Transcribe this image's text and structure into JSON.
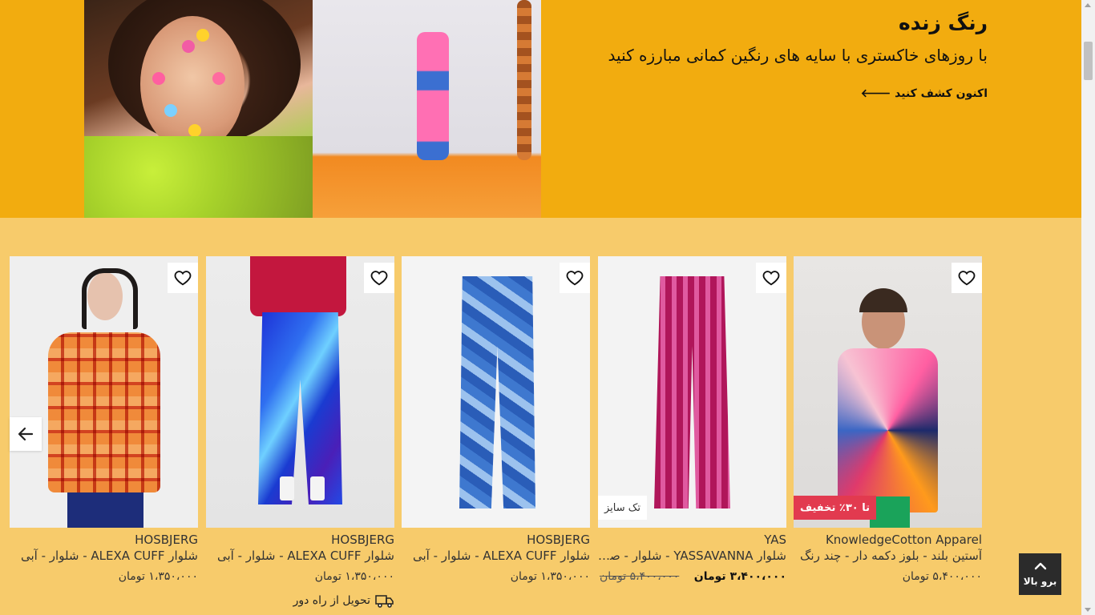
{
  "hero": {
    "title": "رنگ زنده",
    "subtitle": "با روزهای خاکستری با سایه های رنگین کمانی مبارزه کنید",
    "cta": "اکنون کشف کنید",
    "cta_icon": "arrow-left-icon",
    "background": "#f2ac0f"
  },
  "section_background": "#f7cb6b",
  "products": [
    {
      "brand": "KnowledgeCotton Apparel",
      "name": "آستین بلند - بلوز دکمه دار - چند رنگ",
      "price": "۵،۴۰۰،۰۰۰ تومان",
      "badge": "تا ۳۰٪ تخفیف",
      "image": "colorful-shirt-model"
    },
    {
      "brand": "YAS",
      "name": "شلوار YASSAVANNA - شلوار - صو...",
      "price_new": "۳،۴۰۰،۰۰۰ تومان",
      "price_old": "۵،۴۰۰،۰۰۰ تومان",
      "badge": "تک سایز",
      "image": "striped-magenta-trousers"
    },
    {
      "brand": "HOSBJERG",
      "name": "شلوار ALEXA CUFF - شلوار - آبی",
      "price": "۱،۳۵۰،۰۰۰ تومان",
      "image": "blue-patterned-jeans"
    },
    {
      "brand": "HOSBJERG",
      "name": "شلوار ALEXA CUFF - شلوار - آبی",
      "price": "۱،۳۵۰،۰۰۰ تومان",
      "delivery": "تحویل از راه دور",
      "delivery_icon": "truck-icon",
      "image": "blue-satin-trousers-model"
    },
    {
      "brand": "HOSBJERG",
      "name": "شلوار ALEXA CUFF - شلوار - آبی",
      "price": "۱،۳۵۰،۰۰۰ تومان",
      "image": "orange-knit-sweater-model"
    }
  ],
  "favorite_icon": "heart-icon",
  "carousel_prev_icon": "arrow-left-icon",
  "back_to_top": {
    "label": "برو بالا",
    "icon": "chevron-up-icon"
  },
  "colors": {
    "discount_badge": "#e23a4f",
    "back_to_top_bg": "#2b2b2b"
  }
}
